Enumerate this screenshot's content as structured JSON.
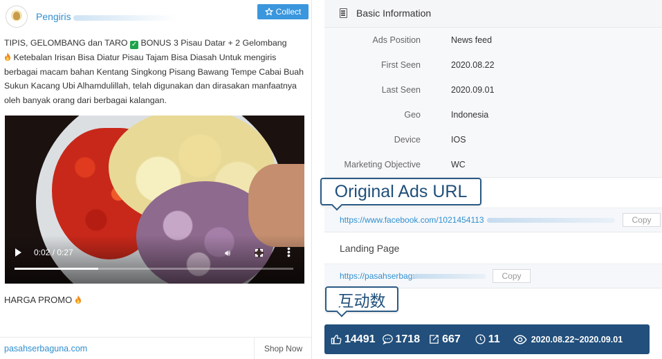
{
  "ad": {
    "page_name": "Pengiris",
    "collect_label": "Collect",
    "text_line1": "TIPIS, GELOMBANG dan TARO ",
    "check_mark": "✓",
    "text_line1b": " BONUS 3 Pisau Datar + 2 Gelombang",
    "text_line2": " Ketebalan Irisan Bisa Diatur Pisau Tajam Bisa Diasah Untuk mengiris berbagai macam bahan Kentang Singkong Pisang Bawang Tempe Cabai Buah Sukun Kacang Ubi Alhamdulillah, telah digunakan dan dirasakan manfaatnya oleh banyak orang dari berbagai kalangan.",
    "video": {
      "time": "0:02 / 0:27",
      "progress_fraction": 0.3
    },
    "caption": "HARGA PROMO ",
    "domain": "pasahserbaguna.com",
    "cta": "Shop Now"
  },
  "info": {
    "title": "Basic Information",
    "rows": [
      {
        "key": "Ads Position",
        "value": "News feed"
      },
      {
        "key": "First Seen",
        "value": "2020.08.22"
      },
      {
        "key": "Last Seen",
        "value": "2020.09.01"
      },
      {
        "key": "Geo",
        "value": "Indonesia"
      },
      {
        "key": "Device",
        "value": "IOS"
      },
      {
        "key": "Marketing Objective",
        "value": "WC"
      }
    ]
  },
  "original_url": {
    "callout": "Original Ads URL",
    "link": "https://www.facebook.com/1021454113",
    "copy": "Copy"
  },
  "landing": {
    "title": "Landing Page",
    "link": "https://pasahserbagu",
    "copy": "Copy"
  },
  "engagement": {
    "callout": "互动数",
    "likes": "14491",
    "comments": "1718",
    "shares": "667",
    "days": "11",
    "date_range": "2020.08.22~2020.09.01"
  },
  "colors": {
    "accent": "#3a96dd",
    "link": "#2f8fd0",
    "stats_bar": "#224f7b"
  }
}
